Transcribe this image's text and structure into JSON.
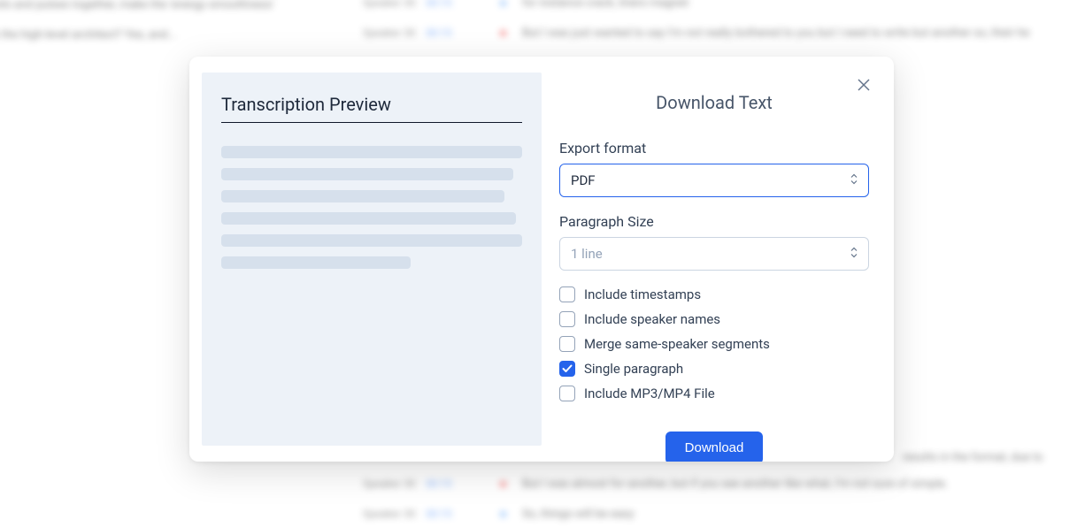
{
  "preview": {
    "title": "Transcription Preview"
  },
  "modal": {
    "title": "Download Text"
  },
  "form": {
    "export_format_label": "Export format",
    "export_format_value": "PDF",
    "paragraph_size_label": "Paragraph Size",
    "paragraph_size_value": "1 line"
  },
  "options": {
    "include_timestamps": {
      "label": "Include timestamps",
      "checked": false
    },
    "include_speaker_names": {
      "label": "Include speaker names",
      "checked": false
    },
    "merge_same_speaker": {
      "label": "Merge same-speaker segments",
      "checked": false
    },
    "single_paragraph": {
      "label": "Single paragraph",
      "checked": true
    },
    "include_media": {
      "label": "Include MP3/MP4 File",
      "checked": false
    }
  },
  "actions": {
    "download": "Download"
  },
  "colors": {
    "primary": "#2563eb",
    "preview_bg": "#edf2f8",
    "text": "#334155"
  }
}
